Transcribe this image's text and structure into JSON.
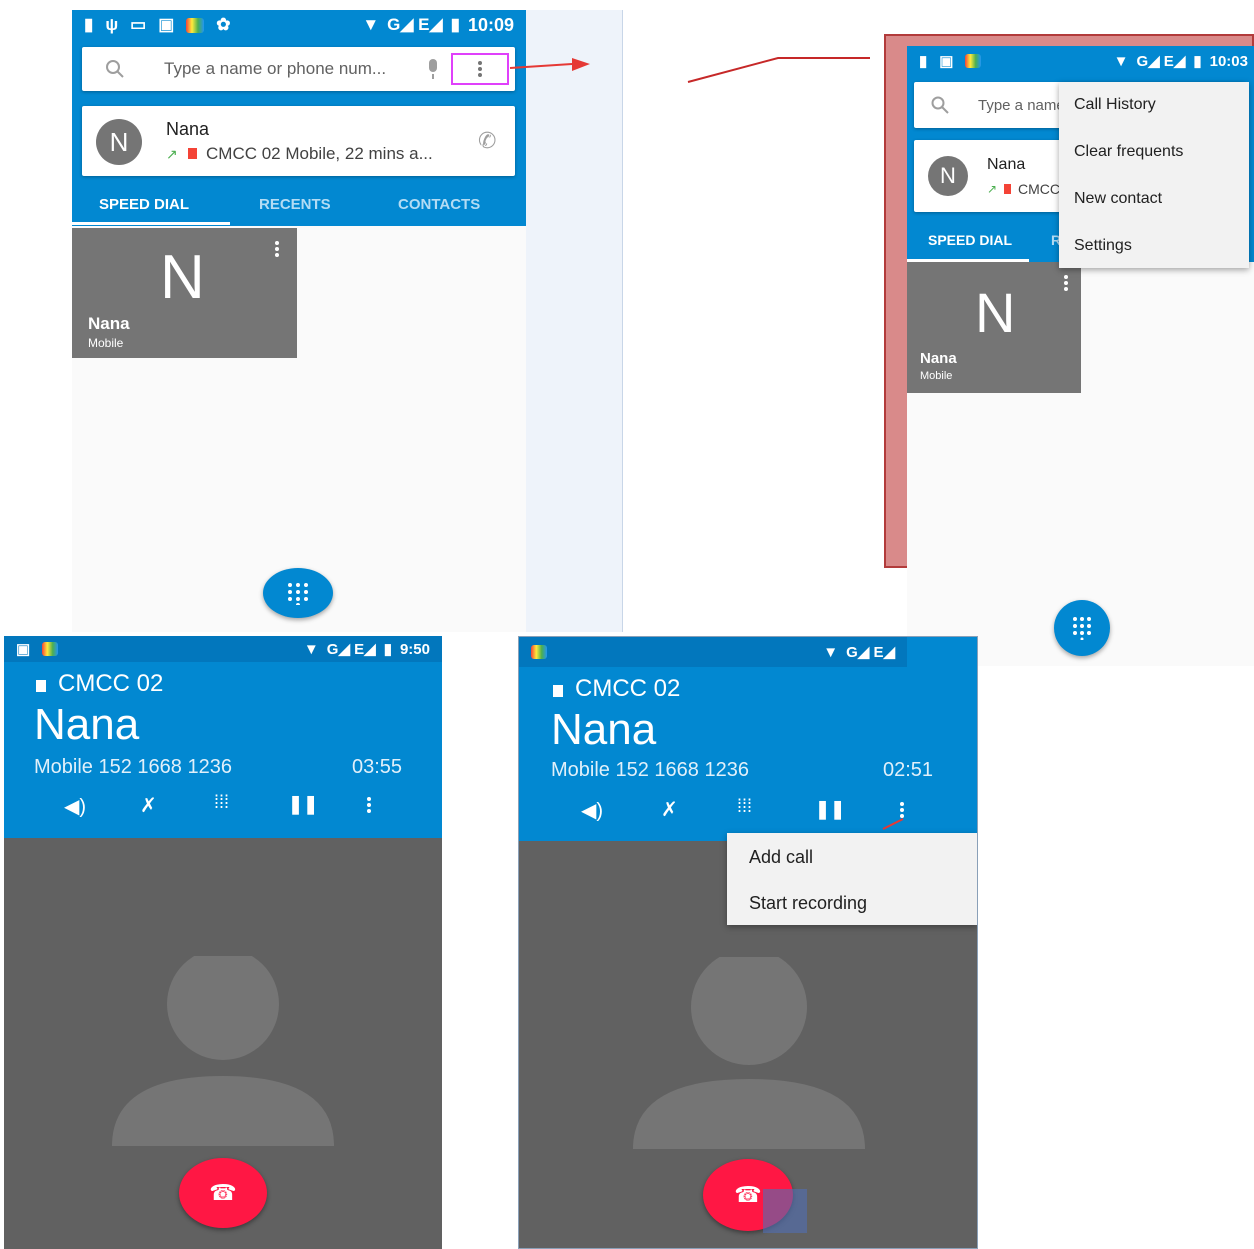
{
  "panel_top_left": {
    "status": {
      "time": "10:09",
      "network": "G◢ E◢"
    },
    "search": {
      "placeholder": "Type a name or phone num..."
    },
    "recent_card": {
      "avatar_letter": "N",
      "name": "Nana",
      "detail": "CMCC 02 Mobile, 22 mins a..."
    },
    "tabs": [
      "SPEED DIAL",
      "RECENTS",
      "CONTACTS"
    ],
    "speed_dial_tile": {
      "letter": "N",
      "name": "Nana",
      "type": "Mobile"
    }
  },
  "panel_top_right": {
    "status": {
      "time": "10:03",
      "network": "G◢ E◢"
    },
    "search": {
      "placeholder": "Type a name"
    },
    "recent_card": {
      "avatar_letter": "N",
      "name": "Nana",
      "detail": "CMCC"
    },
    "tabs": [
      "SPEED DIAL",
      "R"
    ],
    "menu": [
      "Call History",
      "Clear frequents",
      "New contact",
      "Settings"
    ],
    "speed_dial_tile": {
      "letter": "N",
      "name": "Nana",
      "type": "Mobile"
    }
  },
  "panel_bottom_left": {
    "status": {
      "time": "9:50",
      "network": "G◢ E◢"
    },
    "sim": "CMCC 02",
    "name": "Nana",
    "number": "Mobile 152 1668 1236",
    "duration": "03:55"
  },
  "panel_bottom_right": {
    "status": {
      "network": "G◢ E◢"
    },
    "sim": "CMCC 02",
    "name": "Nana",
    "number": "Mobile 152 1668 1236",
    "duration": "02:51",
    "menu": [
      "Add call",
      "Start recording"
    ]
  },
  "colors": {
    "accent": "#0288d1",
    "end_call": "#ff1744",
    "highlight": "#e040fb",
    "arrow": "#e53935"
  }
}
